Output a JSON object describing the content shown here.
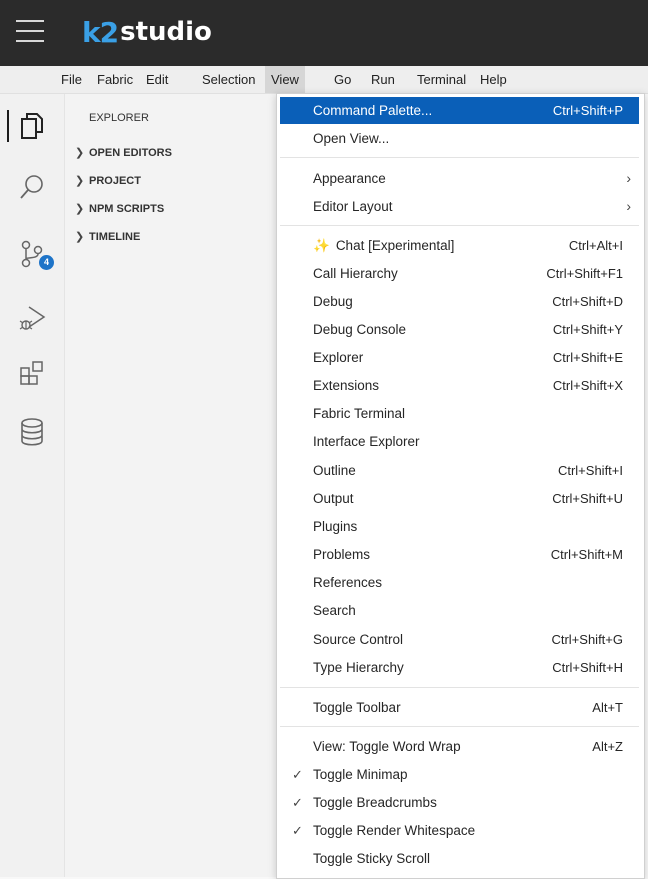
{
  "app": {
    "logo_k2": "k2",
    "logo_studio": "studio"
  },
  "menubar": [
    "File",
    "Fabric",
    "Edit",
    "Selection",
    "View",
    "Go",
    "Run",
    "Terminal",
    "Help"
  ],
  "activity": {
    "scm_badge": "4"
  },
  "sidebar": {
    "title": "EXPLORER",
    "sections": [
      "OPEN EDITORS",
      "PROJECT",
      "NPM SCRIPTS",
      "TIMELINE"
    ]
  },
  "view_menu": {
    "command_palette": {
      "label": "Command Palette...",
      "shortcut": "Ctrl+Shift+P"
    },
    "open_view": {
      "label": "Open View..."
    },
    "appearance": {
      "label": "Appearance"
    },
    "editor_layout": {
      "label": "Editor Layout"
    },
    "chat": {
      "label": "Chat [Experimental]",
      "shortcut": "Ctrl+Alt+I"
    },
    "call_hierarchy": {
      "label": "Call Hierarchy",
      "shortcut": "Ctrl+Shift+F1"
    },
    "debug": {
      "label": "Debug",
      "shortcut": "Ctrl+Shift+D"
    },
    "debug_console": {
      "label": "Debug Console",
      "shortcut": "Ctrl+Shift+Y"
    },
    "explorer": {
      "label": "Explorer",
      "shortcut": "Ctrl+Shift+E"
    },
    "extensions": {
      "label": "Extensions",
      "shortcut": "Ctrl+Shift+X"
    },
    "fabric_terminal": {
      "label": "Fabric Terminal"
    },
    "interface_explorer": {
      "label": "Interface Explorer"
    },
    "outline": {
      "label": "Outline",
      "shortcut": "Ctrl+Shift+I"
    },
    "output": {
      "label": "Output",
      "shortcut": "Ctrl+Shift+U"
    },
    "plugins": {
      "label": "Plugins"
    },
    "problems": {
      "label": "Problems",
      "shortcut": "Ctrl+Shift+M"
    },
    "references": {
      "label": "References"
    },
    "search": {
      "label": "Search"
    },
    "source_control": {
      "label": "Source Control",
      "shortcut": "Ctrl+Shift+G"
    },
    "type_hierarchy": {
      "label": "Type Hierarchy",
      "shortcut": "Ctrl+Shift+H"
    },
    "toggle_toolbar": {
      "label": "Toggle Toolbar",
      "shortcut": "Alt+T"
    },
    "toggle_word_wrap": {
      "label": "View: Toggle Word Wrap",
      "shortcut": "Alt+Z"
    },
    "toggle_minimap": {
      "label": "Toggle Minimap",
      "checked": true
    },
    "toggle_breadcrumbs": {
      "label": "Toggle Breadcrumbs",
      "checked": true
    },
    "toggle_render_whitespace": {
      "label": "Toggle Render Whitespace",
      "checked": true
    },
    "toggle_sticky_scroll": {
      "label": "Toggle Sticky Scroll",
      "checked": false
    }
  },
  "colors": {
    "accent": "#0a5fb8",
    "badge": "#1e74c8",
    "logo_blue": "#3aa0e6",
    "topbar": "#2b2b2b"
  }
}
